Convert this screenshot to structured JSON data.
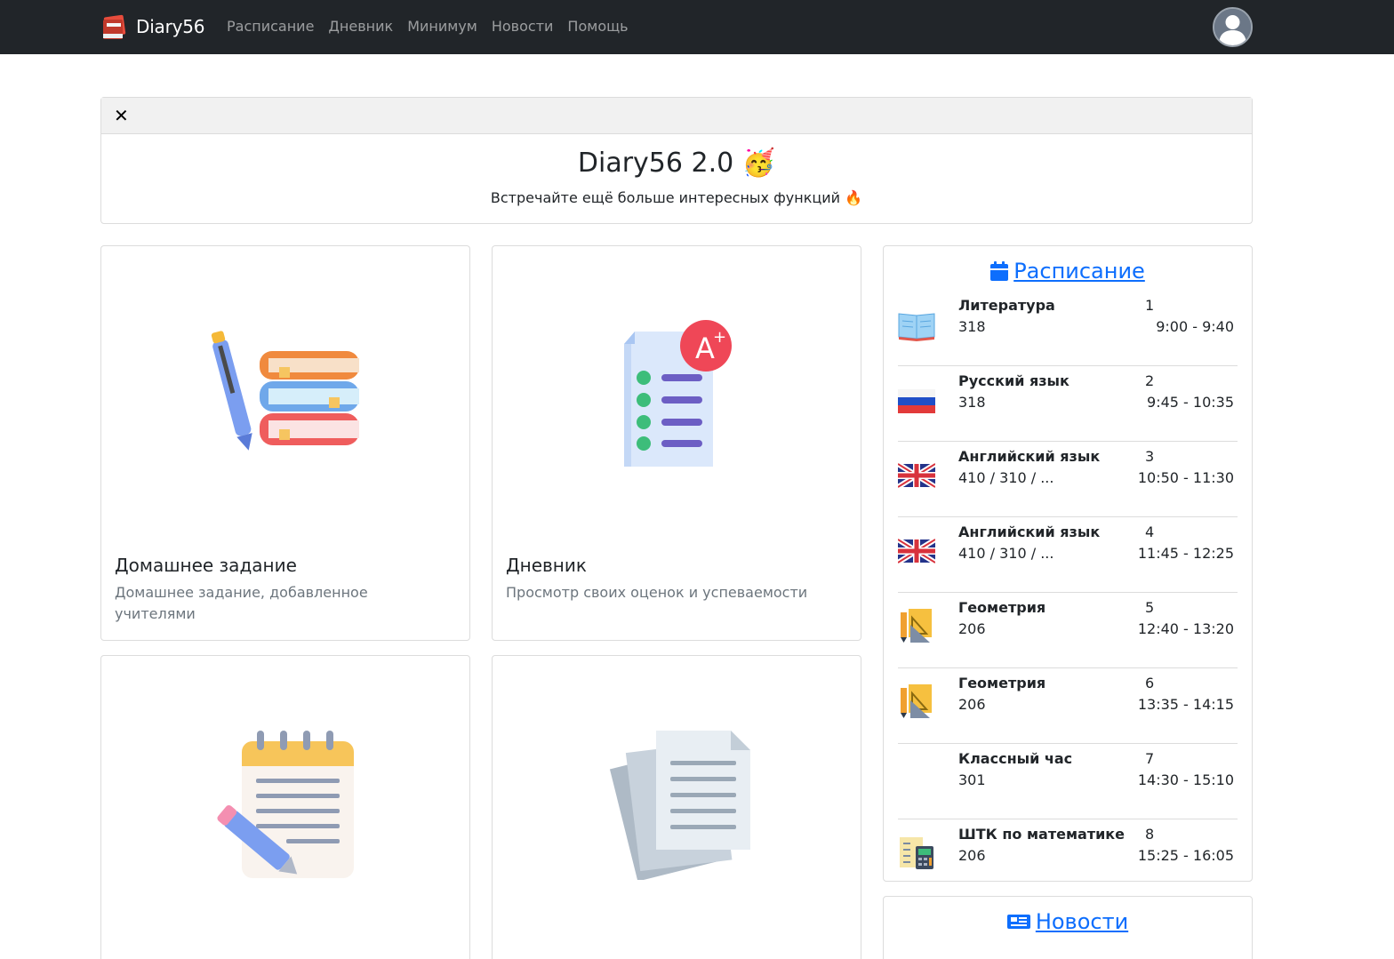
{
  "navbar": {
    "brand": "Diary56",
    "links": [
      "Расписание",
      "Дневник",
      "Минимум",
      "Новости",
      "Помощь"
    ]
  },
  "announcement": {
    "title": "Diary56 2.0 🥳",
    "subtitle": "Встречайте ещё больше интересных функций 🔥"
  },
  "cards": [
    {
      "title": "Домашнее задание",
      "text": "Домашнее задание, добавленное учителями"
    },
    {
      "title": "Дневник",
      "text": "Просмотр своих оценок и успеваемости"
    },
    {
      "title": "",
      "text": ""
    },
    {
      "title": "",
      "text": ""
    }
  ],
  "schedule": {
    "title": "Расписание",
    "lessons": [
      {
        "name": "Литература",
        "room": "318",
        "num": "1",
        "time": "9:00 - 9:40",
        "icon": "book-icon"
      },
      {
        "name": "Русский язык",
        "room": "318",
        "num": "2",
        "time": "9:45 - 10:35",
        "icon": "russia-flag-icon"
      },
      {
        "name": "Английский язык",
        "room": "410 / 310 / ...",
        "num": "3",
        "time": "10:50 - 11:30",
        "icon": "uk-flag-icon"
      },
      {
        "name": "Английский язык",
        "room": "410 / 310 / ...",
        "num": "4",
        "time": "11:45 - 12:25",
        "icon": "uk-flag-icon"
      },
      {
        "name": "Геометрия",
        "room": "206",
        "num": "5",
        "time": "12:40 - 13:20",
        "icon": "geometry-icon"
      },
      {
        "name": "Геометрия",
        "room": "206",
        "num": "6",
        "time": "13:35 - 14:15",
        "icon": "geometry-icon"
      },
      {
        "name": "Классный час",
        "room": "301",
        "num": "7",
        "time": "14:30 - 15:10",
        "icon": ""
      },
      {
        "name": "ШТК по математике",
        "room": "206",
        "num": "8",
        "time": "15:25 - 16:05",
        "icon": "calculator-icon"
      }
    ]
  },
  "news": {
    "title": "Новости"
  },
  "colors": {
    "navbar": "#212529",
    "link": "#0d6efd",
    "muted": "#6c757d"
  }
}
